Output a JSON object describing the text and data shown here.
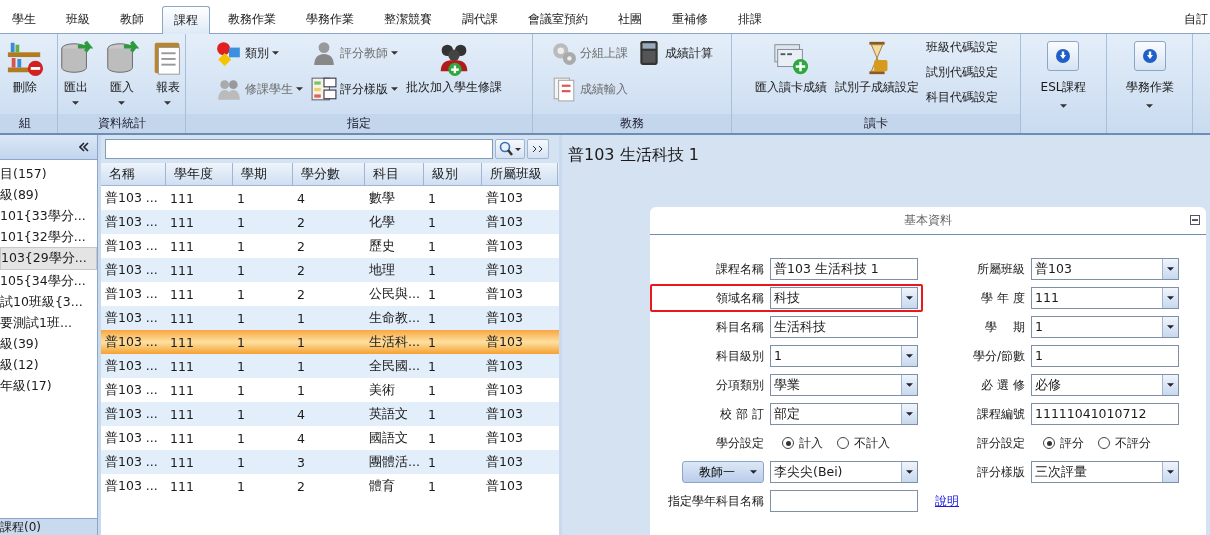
{
  "tabs": [
    {
      "label": "學生",
      "selected": false
    },
    {
      "label": "班級",
      "selected": false
    },
    {
      "label": "教師",
      "selected": false
    },
    {
      "label": "課程",
      "selected": true
    },
    {
      "label": "教務作業",
      "selected": false
    },
    {
      "label": "學務作業",
      "selected": false
    },
    {
      "label": "整潔競賽",
      "selected": false
    },
    {
      "label": "調代課",
      "selected": false
    },
    {
      "label": "會議室預約",
      "selected": false
    },
    {
      "label": "社團",
      "selected": false
    },
    {
      "label": "重補修",
      "selected": false
    },
    {
      "label": "排課",
      "selected": false
    }
  ],
  "tabs_right": "自訂",
  "ribbon": {
    "groups": [
      {
        "label": "組",
        "columns": [
          [
            {
              "kind": "large",
              "label": "刪除",
              "dropdown": false,
              "disabled": false
            }
          ]
        ]
      },
      {
        "label": "資料統計",
        "columns": [
          [
            {
              "kind": "large",
              "label": "匯出",
              "dropdown": true,
              "disabled": false
            }
          ],
          [
            {
              "kind": "large",
              "label": "匯入",
              "dropdown": true,
              "disabled": false
            }
          ],
          [
            {
              "kind": "large",
              "label": "報表",
              "dropdown": true,
              "disabled": false
            }
          ]
        ]
      },
      {
        "label": "指定",
        "columns": [
          [
            {
              "kind": "small",
              "label": "類別",
              "dropdown": true,
              "disabled": false
            },
            {
              "kind": "small",
              "label": "修課學生",
              "dropdown": true,
              "disabled": true
            }
          ],
          [
            {
              "kind": "small",
              "label": "評分教師",
              "dropdown": true,
              "disabled": true
            },
            {
              "kind": "small",
              "label": "評分樣版",
              "dropdown": true,
              "disabled": false
            }
          ],
          [
            {
              "kind": "large",
              "label": "批次加入學生修課",
              "dropdown": false,
              "disabled": false
            }
          ]
        ]
      },
      {
        "label": "教務",
        "columns": [
          [
            {
              "kind": "small",
              "label": "分組上課",
              "dropdown": false,
              "disabled": true
            },
            {
              "kind": "small",
              "label": "成績輸入",
              "dropdown": false,
              "disabled": true
            }
          ],
          [
            {
              "kind": "small",
              "label": "成績計算",
              "dropdown": false,
              "disabled": false
            }
          ]
        ]
      },
      {
        "label": "讀卡",
        "columns": [
          [
            {
              "kind": "large",
              "label": "匯入讀卡成績",
              "dropdown": false,
              "disabled": false
            }
          ],
          [
            {
              "kind": "large",
              "label": "試別子成績設定",
              "dropdown": false,
              "disabled": false
            }
          ],
          [
            {
              "kind": "text",
              "label": "班級代碼設定",
              "dropdown": false,
              "disabled": false
            },
            {
              "kind": "text",
              "label": "試別代碼設定",
              "dropdown": false,
              "disabled": false
            },
            {
              "kind": "text",
              "label": "科目代碼設定",
              "dropdown": false,
              "disabled": false
            }
          ]
        ]
      },
      {
        "columns": [
          [
            {
              "kind": "boxed",
              "label": "ESL課程",
              "dropdown": true,
              "disabled": false
            }
          ]
        ]
      },
      {
        "columns": [
          [
            {
              "kind": "boxed",
              "label": "學務作業",
              "dropdown": true,
              "disabled": false
            }
          ]
        ]
      }
    ]
  },
  "sidebar": {
    "items": [
      {
        "label": "目(157)",
        "selected": false
      },
      {
        "label": "級(89)",
        "selected": false
      },
      {
        "label": "101{33學分...",
        "selected": false
      },
      {
        "label": "101{32學分...",
        "selected": false
      },
      {
        "label": "103{29學分...",
        "selected": true
      },
      {
        "label": "105{34學分...",
        "selected": false
      },
      {
        "label": "試10班級{3...",
        "selected": false
      },
      {
        "label": "要測試1班...",
        "selected": false
      },
      {
        "label": "級(39)",
        "selected": false
      },
      {
        "label": "級(12)",
        "selected": false
      },
      {
        "label": "年級(17)",
        "selected": false
      }
    ],
    "footer": "課程(0)"
  },
  "table": {
    "columns": [
      "名稱",
      "學年度",
      "學期",
      "學分數",
      "科目",
      "級別",
      "所屬班級"
    ],
    "rows": [
      {
        "cells": [
          "普103 ...",
          "111",
          "1",
          "4",
          "數學",
          "1",
          "普103"
        ],
        "selected": false
      },
      {
        "cells": [
          "普103 ...",
          "111",
          "1",
          "2",
          "化學",
          "1",
          "普103"
        ],
        "selected": false
      },
      {
        "cells": [
          "普103 ...",
          "111",
          "1",
          "2",
          "歷史",
          "1",
          "普103"
        ],
        "selected": false
      },
      {
        "cells": [
          "普103 ...",
          "111",
          "1",
          "2",
          "地理",
          "1",
          "普103"
        ],
        "selected": false
      },
      {
        "cells": [
          "普103 ...",
          "111",
          "1",
          "2",
          "公民與...",
          "1",
          "普103"
        ],
        "selected": false
      },
      {
        "cells": [
          "普103 ...",
          "111",
          "1",
          "1",
          "生命教...",
          "1",
          "普103"
        ],
        "selected": false
      },
      {
        "cells": [
          "普103 ...",
          "111",
          "1",
          "1",
          "生活科...",
          "1",
          "普103"
        ],
        "selected": true
      },
      {
        "cells": [
          "普103 ...",
          "111",
          "1",
          "1",
          "全民國...",
          "1",
          "普103"
        ],
        "selected": false
      },
      {
        "cells": [
          "普103 ...",
          "111",
          "1",
          "1",
          "美術",
          "1",
          "普103"
        ],
        "selected": false
      },
      {
        "cells": [
          "普103 ...",
          "111",
          "1",
          "4",
          "英語文",
          "1",
          "普103"
        ],
        "selected": false
      },
      {
        "cells": [
          "普103 ...",
          "111",
          "1",
          "4",
          "國語文",
          "1",
          "普103"
        ],
        "selected": false
      },
      {
        "cells": [
          "普103 ...",
          "111",
          "1",
          "3",
          "團體活...",
          "1",
          "普103"
        ],
        "selected": false
      },
      {
        "cells": [
          "普103 ...",
          "111",
          "1",
          "2",
          "體育",
          "1",
          "普103"
        ],
        "selected": false
      }
    ]
  },
  "detail": {
    "title": "普103 生活科技 1",
    "form": {
      "title": "基本資料",
      "rows": [
        {
          "left": {
            "label": "課程名稱",
            "label_button": false,
            "kind": "text",
            "value": "普103 生活科技 1",
            "highlighted": false
          },
          "right": {
            "label": "所屬班級",
            "label_button": false,
            "kind": "select",
            "value": "普103",
            "highlighted": false
          }
        },
        {
          "left": {
            "label": "領域名稱",
            "label_button": false,
            "kind": "select",
            "value": "科技",
            "highlighted": true
          },
          "right": {
            "label": "學 年 度",
            "label_button": false,
            "kind": "select",
            "value": "111",
            "highlighted": false
          }
        },
        {
          "left": {
            "label": "科目名稱",
            "label_button": false,
            "kind": "text",
            "value": "生活科技",
            "highlighted": false
          },
          "right": {
            "label": "學　 期",
            "label_button": false,
            "kind": "select",
            "value": "1",
            "highlighted": false
          }
        },
        {
          "left": {
            "label": "科目級別",
            "label_button": false,
            "kind": "select",
            "value": "1",
            "highlighted": false
          },
          "right": {
            "label": "學分/節數",
            "label_button": false,
            "kind": "text",
            "value": "1",
            "highlighted": false
          }
        },
        {
          "left": {
            "label": "分項類別",
            "label_button": false,
            "kind": "select",
            "value": "學業",
            "highlighted": false
          },
          "right": {
            "label": "必 選 修",
            "label_button": false,
            "kind": "select",
            "value": "必修",
            "highlighted": false
          }
        },
        {
          "left": {
            "label": "校 部 訂",
            "label_button": false,
            "kind": "select",
            "value": "部定",
            "highlighted": false
          },
          "right": {
            "label": "課程編號",
            "label_button": false,
            "kind": "text",
            "value": "11111041010712",
            "highlighted": false
          }
        },
        {
          "left": {
            "label": "學分設定",
            "label_button": false,
            "kind": "radio",
            "options": [
              {
                "label": "計入",
                "selected": true
              },
              {
                "label": "不計入",
                "selected": false
              }
            ],
            "highlighted": false
          },
          "right": {
            "label": "評分設定",
            "label_button": false,
            "kind": "radio",
            "options": [
              {
                "label": "評分",
                "selected": true
              },
              {
                "label": "不評分",
                "selected": false
              }
            ],
            "highlighted": false
          }
        },
        {
          "left": {
            "label": "教師一",
            "label_button": true,
            "kind": "select",
            "value": "李尖尖(Bei)",
            "highlighted": false
          },
          "right": {
            "label": "評分樣版",
            "label_button": false,
            "kind": "select",
            "value": "三次評量",
            "highlighted": false
          }
        },
        {
          "left": {
            "label": "指定學年科目名稱",
            "label_button": false,
            "kind": "text",
            "highlighted": false
          },
          "link": "說明"
        }
      ]
    }
  }
}
